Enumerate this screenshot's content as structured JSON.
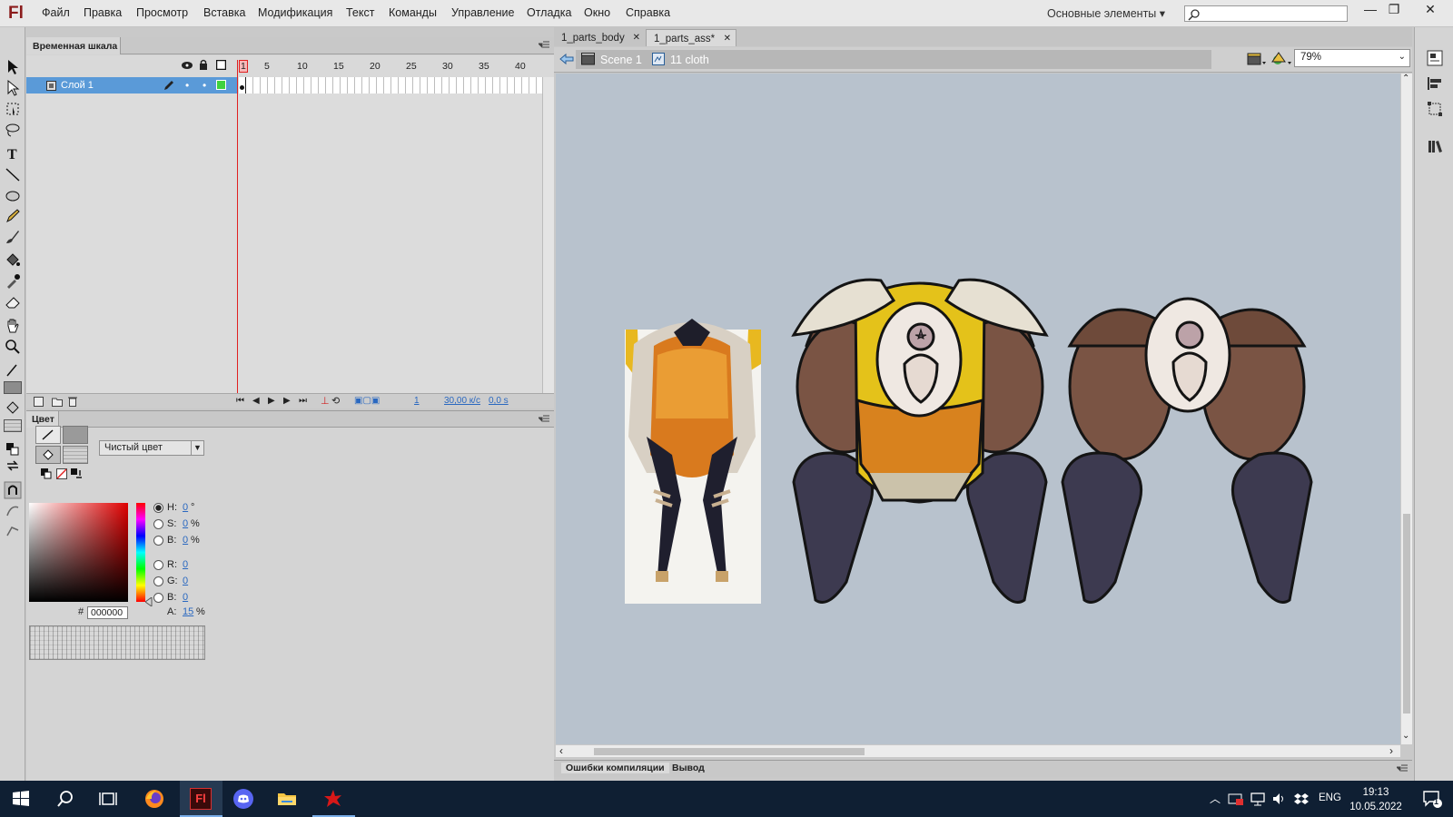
{
  "app": {
    "logo": "Fl"
  },
  "menu": [
    "Файл",
    "Правка",
    "Просмотр",
    "Вставка",
    "Модификация",
    "Текст",
    "Команды",
    "Управление",
    "Отладка",
    "Окно",
    "Справка"
  ],
  "workspace": {
    "label": "Основные элементы"
  },
  "timeline": {
    "tab_label": "Временная шкала",
    "frame_numbers": [
      "1",
      "5",
      "10",
      "15",
      "20",
      "25",
      "30",
      "35",
      "40"
    ],
    "layer_name": "Слой 1",
    "current_frame": "1",
    "fps": "30,00 к/с",
    "time": "0,0 s"
  },
  "color_panel": {
    "tab_label": "Цвет",
    "fill_type": "Чистый цвет",
    "h_label": "H:",
    "h_value": "0",
    "h_unit": "°",
    "s_label": "S:",
    "s_value": "0",
    "s_unit": "%",
    "b_label": "B:",
    "b_value": "0",
    "b_unit": "%",
    "r_label": "R:",
    "r_value": "0",
    "g_label": "G:",
    "g_value": "0",
    "bb_label": "B:",
    "bb_value": "0",
    "a_label": "A:",
    "a_value": "15",
    "a_unit": "%",
    "hex_label": "#",
    "hex_value": "000000"
  },
  "documents": {
    "tabs": [
      {
        "label": "1_parts_body"
      },
      {
        "label": "1_parts_ass*"
      }
    ],
    "active_tab": 1
  },
  "edit_bar": {
    "scene": "Scene 1",
    "symbol": "11 cloth",
    "zoom": "79%"
  },
  "output_tabs": [
    "Ошибки компиляции",
    "Вывод"
  ],
  "taskbar": {
    "lang": "ENG",
    "time": "19:13",
    "date": "10.05.2022",
    "notifications": "1"
  },
  "colors": {
    "stage_bg": "#b8c2cd",
    "layer_highlight": "#5a9ad8",
    "playhead": "#e02020",
    "taskbar_bg": "#0f1f33"
  }
}
